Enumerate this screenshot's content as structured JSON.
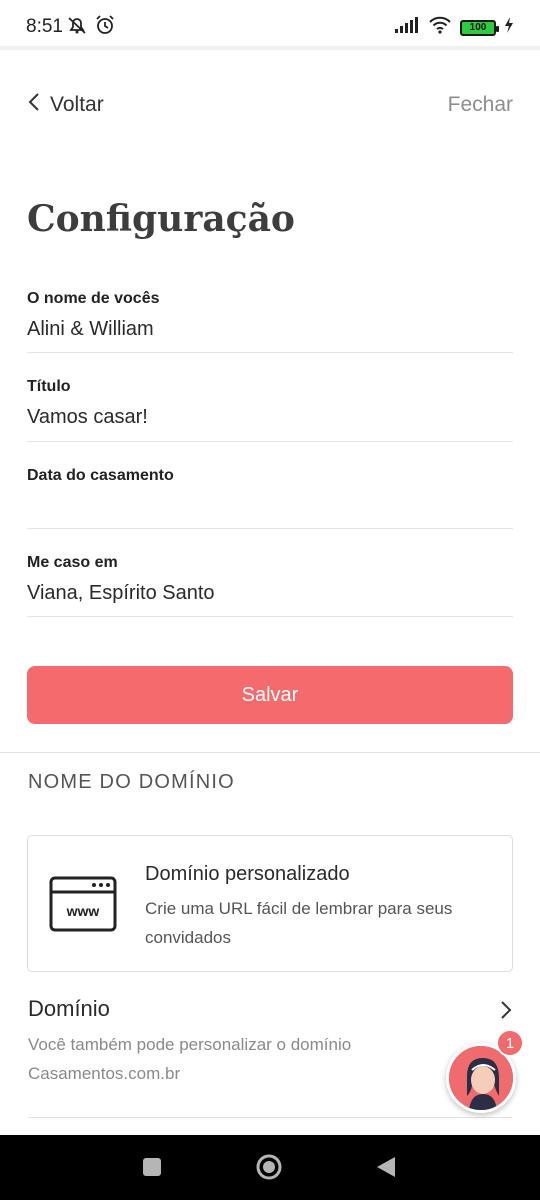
{
  "status_bar": {
    "time": "8:51",
    "battery": "100"
  },
  "header": {
    "back_label": "Voltar",
    "close_label": "Fechar"
  },
  "page_title": "Configuração",
  "fields": [
    {
      "label": "O nome de vocês",
      "value": "Alini & William"
    },
    {
      "label": "Título",
      "value": "Vamos casar!"
    },
    {
      "label": "Data do casamento",
      "value": ""
    },
    {
      "label": "Me caso em",
      "value": "Viana, Espírito Santo"
    }
  ],
  "save_button": "Salvar",
  "domain_section": {
    "title": "NOME DO DOMÍNIO",
    "card": {
      "title": "Domínio personalizado",
      "description": "Crie uma URL fácil de lembrar para seus convidados",
      "icon_text": "www"
    },
    "row": {
      "title": "Domínio",
      "description": "Você também pode personalizar o domínio Casamentos.com.br"
    }
  },
  "assistant": {
    "badge_count": "1"
  },
  "colors": {
    "accent": "#f56a6c",
    "text": "#2b2b2b",
    "muted": "#8a8a8a"
  }
}
